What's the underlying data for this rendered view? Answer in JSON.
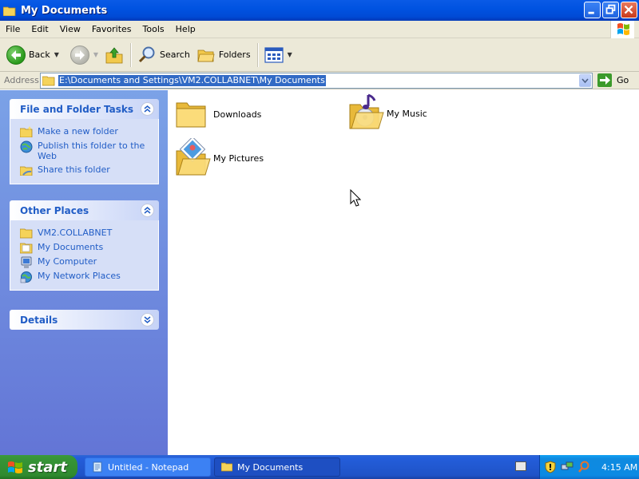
{
  "window": {
    "title": "My Documents",
    "icon": "folder-icon"
  },
  "menu": [
    "File",
    "Edit",
    "View",
    "Favorites",
    "Tools",
    "Help"
  ],
  "toolbar": {
    "back_label": "Back",
    "search_label": "Search",
    "folders_label": "Folders",
    "icons": [
      "back-arrow-icon",
      "forward-arrow-icon",
      "up-folder-icon",
      "search-icon",
      "folders-icon",
      "views-icon"
    ]
  },
  "address": {
    "label": "Address",
    "value": "E:\\Documents and Settings\\VM2.COLLABNET\\My Documents",
    "go_label": "Go"
  },
  "tasks_panel": {
    "title": "File and Folder Tasks",
    "items": [
      {
        "label": "Make a new folder",
        "icon": "new-folder-icon"
      },
      {
        "label": "Publish this folder to the Web",
        "icon": "globe-publish-icon"
      },
      {
        "label": "Share this folder",
        "icon": "share-folder-icon"
      }
    ]
  },
  "places_panel": {
    "title": "Other Places",
    "items": [
      {
        "label": "VM2.COLLABNET",
        "icon": "folder-icon"
      },
      {
        "label": "My Documents",
        "icon": "my-documents-icon"
      },
      {
        "label": "My Computer",
        "icon": "my-computer-icon"
      },
      {
        "label": "My Network Places",
        "icon": "network-places-icon"
      }
    ]
  },
  "details_panel": {
    "title": "Details"
  },
  "folders": [
    {
      "label": "Downloads",
      "icon": "folder-icon"
    },
    {
      "label": "My Music",
      "icon": "music-folder-icon"
    },
    {
      "label": "My Pictures",
      "icon": "pictures-folder-icon"
    }
  ],
  "taskbar": {
    "start_label": "start",
    "tasks": [
      {
        "label": "Untitled - Notepad",
        "icon": "notepad-icon",
        "active": false
      },
      {
        "label": "My Documents",
        "icon": "folder-icon",
        "active": true
      }
    ],
    "clock": "4:15 AM"
  },
  "colors": {
    "title_bar": "#0053e1",
    "task_pane": "#6375d6",
    "link": "#215dc6",
    "selection": "#316ac5",
    "start_button": "#379537"
  }
}
